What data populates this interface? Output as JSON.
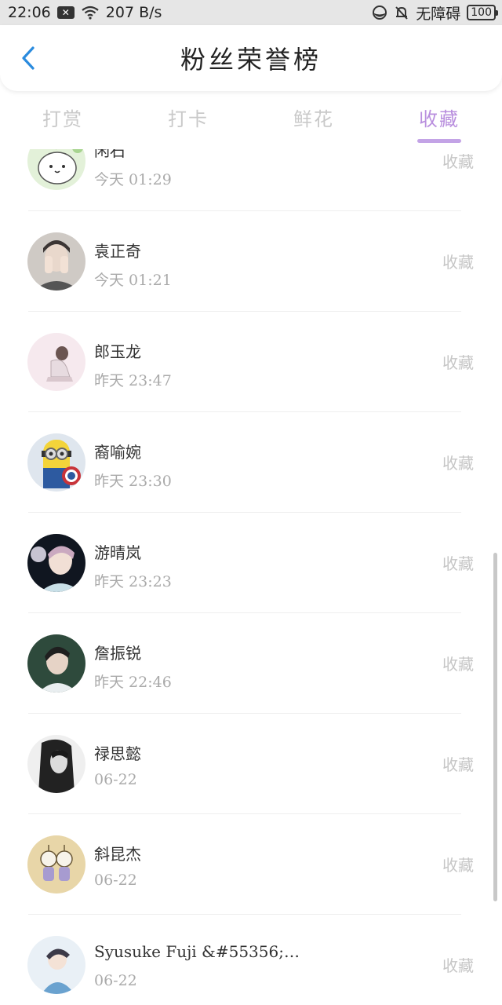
{
  "status_bar": {
    "time": "22:06",
    "speed": "207 B/s",
    "accessibility": "无障碍",
    "battery": "100"
  },
  "header": {
    "title": "粉丝荣誉榜"
  },
  "tabs": [
    {
      "label": "打赏",
      "active": false
    },
    {
      "label": "打卡",
      "active": false
    },
    {
      "label": "鲜花",
      "active": false
    },
    {
      "label": "收藏",
      "active": true
    }
  ],
  "rows": [
    {
      "name": "闲石",
      "time": "今天 01:29",
      "action": "收藏",
      "avatar": "cartoon-bunny"
    },
    {
      "name": "袁正奇",
      "time": "今天 01:21",
      "action": "收藏",
      "avatar": "person-hands-face"
    },
    {
      "name": "郎玉龙",
      "time": "昨天 23:47",
      "action": "收藏",
      "avatar": "girl-sitting"
    },
    {
      "name": "裔喻婉",
      "time": "昨天 23:30",
      "action": "收藏",
      "avatar": "minion-captain"
    },
    {
      "name": "游晴岚",
      "time": "昨天 23:23",
      "action": "收藏",
      "avatar": "portrait-light"
    },
    {
      "name": "詹振锐",
      "time": "昨天 22:46",
      "action": "收藏",
      "avatar": "portrait-green"
    },
    {
      "name": "禄思懿",
      "time": "06-22",
      "action": "收藏",
      "avatar": "portrait-bw"
    },
    {
      "name": "斜昆杰",
      "time": "06-22",
      "action": "收藏",
      "avatar": "cartoon-figures"
    },
    {
      "name": "Syusuke Fuji &#55356;…",
      "time": "06-22",
      "action": "收藏",
      "avatar": "anime-boy"
    }
  ],
  "colors": {
    "accent": "#b98fde",
    "accent_underline": "#c3a3e6",
    "back_arrow": "#2a8bde",
    "inactive_tab": "#c9c9c9",
    "status_bar_bg": "#e6e6e6"
  }
}
